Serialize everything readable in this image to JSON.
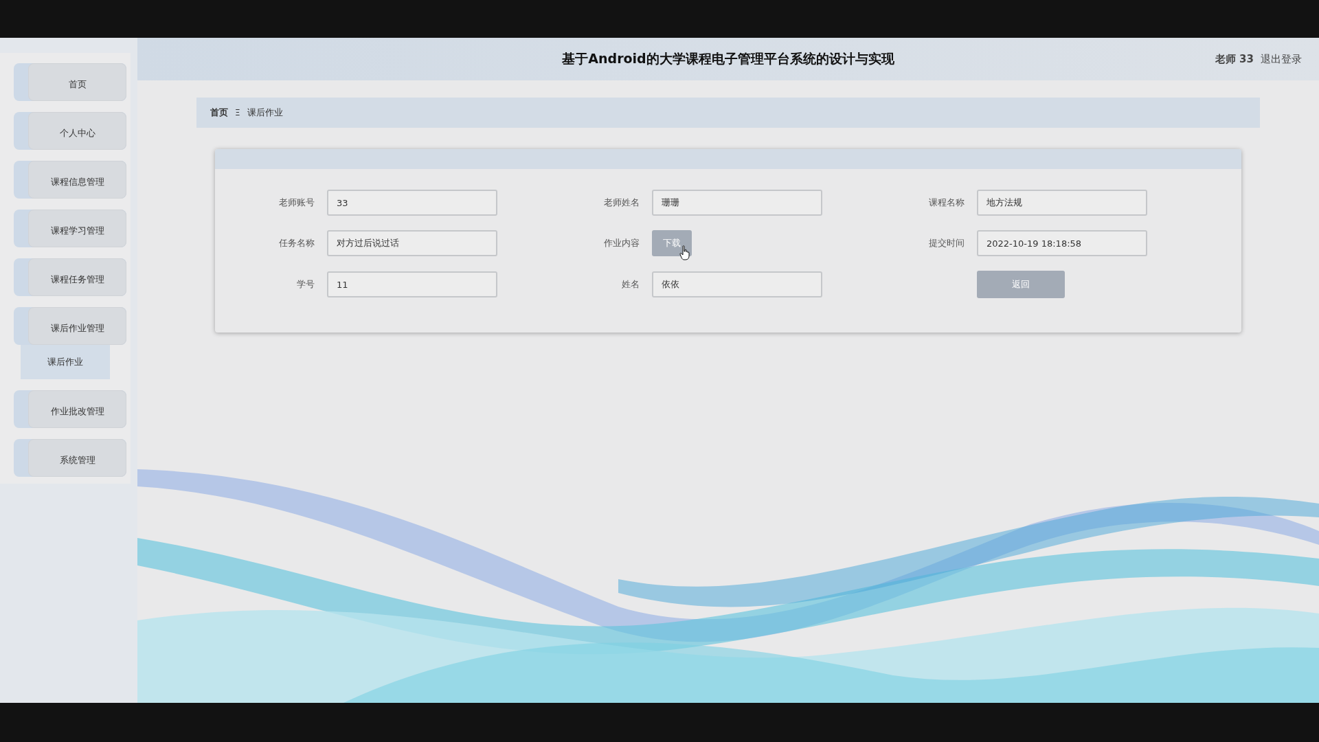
{
  "header": {
    "title": "基于Android的大学课程电子管理平台系统的设计与实现",
    "user": "老师 33",
    "logout": "退出登录"
  },
  "sidebar": {
    "items": [
      {
        "label": "首页"
      },
      {
        "label": "个人中心"
      },
      {
        "label": "课程信息管理"
      },
      {
        "label": "课程学习管理"
      },
      {
        "label": "课程任务管理"
      },
      {
        "label": "课后作业管理",
        "children": [
          {
            "label": "课后作业"
          }
        ]
      },
      {
        "label": "作业批改管理"
      },
      {
        "label": "系统管理"
      }
    ]
  },
  "breadcrumb": {
    "items": [
      "首页",
      "课后作业"
    ],
    "separator": "Ξ"
  },
  "form": {
    "fields": [
      {
        "label": "老师账号",
        "kind": "input",
        "value": "33"
      },
      {
        "label": "老师姓名",
        "kind": "input",
        "value": "珊珊"
      },
      {
        "label": "课程名称",
        "kind": "input",
        "value": "地方法规"
      },
      {
        "label": "任务名称",
        "kind": "input",
        "value": "对方过后说过话"
      },
      {
        "label": "作业内容",
        "kind": "button",
        "value": "下载"
      },
      {
        "label": "提交时间",
        "kind": "input",
        "value": "2022-10-19 18:18:58"
      },
      {
        "label": "学号",
        "kind": "input",
        "value": "11"
      },
      {
        "label": "姓名",
        "kind": "input",
        "value": "依依"
      }
    ],
    "back_button": "返回"
  }
}
